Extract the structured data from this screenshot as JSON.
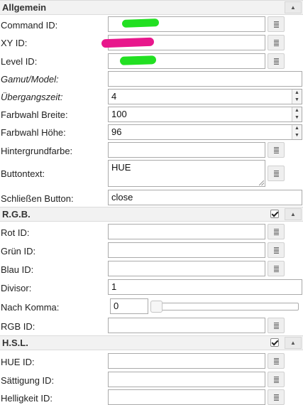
{
  "sections": {
    "allgemein": {
      "title": "Allgemein",
      "collapse_icon": "chevron-up-icon"
    },
    "rgb": {
      "title": "R.G.B.",
      "enabled": true,
      "collapse_icon": "chevron-up-icon"
    },
    "hsl": {
      "title": "H.S.L.",
      "enabled": true,
      "collapse_icon": "chevron-up-icon"
    }
  },
  "labels": {
    "command_id": "Command ID:",
    "xy_id": "XY ID:",
    "level_id": "Level ID:",
    "gamut_model": "Gamut/Model:",
    "uebergangszeit": "Übergangszeit:",
    "farbwahl_breite": "Farbwahl Breite:",
    "farbwahl_hoehe": "Farbwahl Höhe:",
    "hintergrundfarbe": "Hintergrundfarbe:",
    "buttontext": "Buttontext:",
    "schliessen_button": "Schließen Button:",
    "rot_id": "Rot ID:",
    "gruen_id": "Grün ID:",
    "blau_id": "Blau ID:",
    "divisor": "Divisor:",
    "nach_komma": "Nach Komma:",
    "rgb_id": "RGB ID:",
    "hue_id": "HUE ID:",
    "saettigung_id": "Sättigung ID:",
    "helligkeit_id": "Helligkeit ID:"
  },
  "values": {
    "command_id": "",
    "xy_id": "",
    "level_id": "",
    "gamut_model": "",
    "uebergangszeit": "4",
    "farbwahl_breite": "100",
    "farbwahl_hoehe": "96",
    "hintergrundfarbe": "",
    "buttontext": "HUE",
    "schliessen_button": "close",
    "rot_id": "",
    "gruen_id": "",
    "blau_id": "",
    "divisor": "1",
    "nach_komma": "0",
    "nach_komma_slider_fraction": 0,
    "rgb_id": "",
    "hue_id": "",
    "saettigung_id": "",
    "helligkeit_id": ""
  },
  "redaction_colors": {
    "green": "#22e022",
    "magenta": "#e8178c"
  },
  "icons": {
    "picker": "list-icon",
    "spinner_up": "spin-up-icon",
    "spinner_down": "spin-down-icon"
  }
}
